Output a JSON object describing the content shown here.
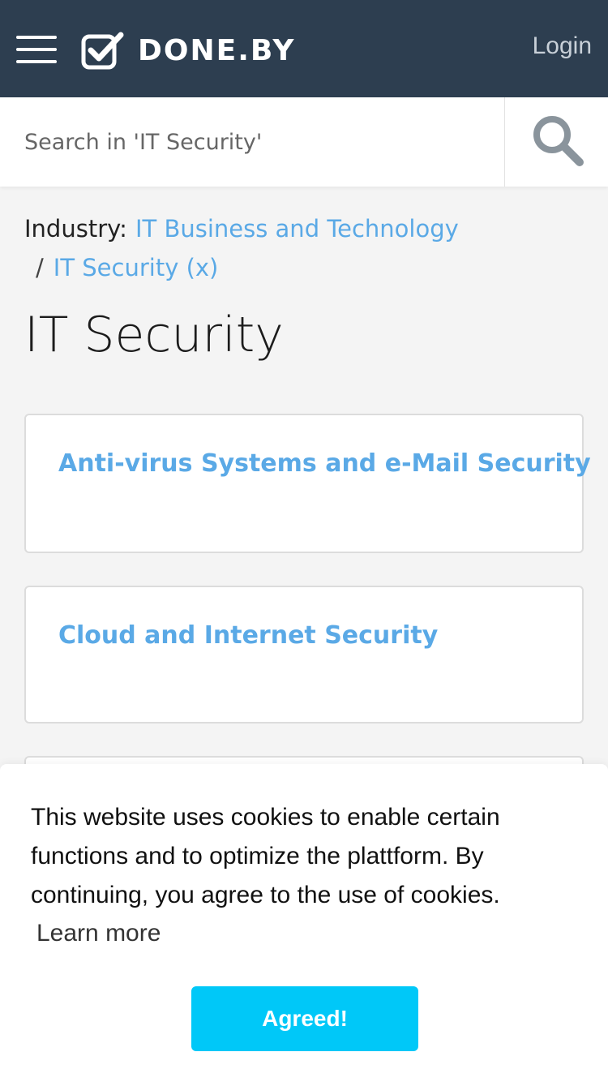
{
  "header": {
    "brand": "DONE.BY",
    "login_label": "Login"
  },
  "search": {
    "placeholder": "Search in 'IT Security'"
  },
  "breadcrumb": {
    "label": "Industry:",
    "parent": "IT Business and Technology",
    "separator": "/",
    "current": "IT Security (x)"
  },
  "page": {
    "title": "IT Security"
  },
  "categories": [
    {
      "title": "Anti-virus Systems and e-Mail Security"
    },
    {
      "title": "Cloud and Internet Security"
    }
  ],
  "cookie": {
    "text": "This website uses cookies to enable certain functions and to optimize the plattform. By continuing, you agree to the use of cookies.",
    "learn_more": "Learn more",
    "button": "Agreed!"
  },
  "colors": {
    "header_bg": "#2d3e50",
    "link": "#5aa9e6",
    "accent_button": "#00c8f8",
    "page_bg": "#f4f4f4"
  }
}
